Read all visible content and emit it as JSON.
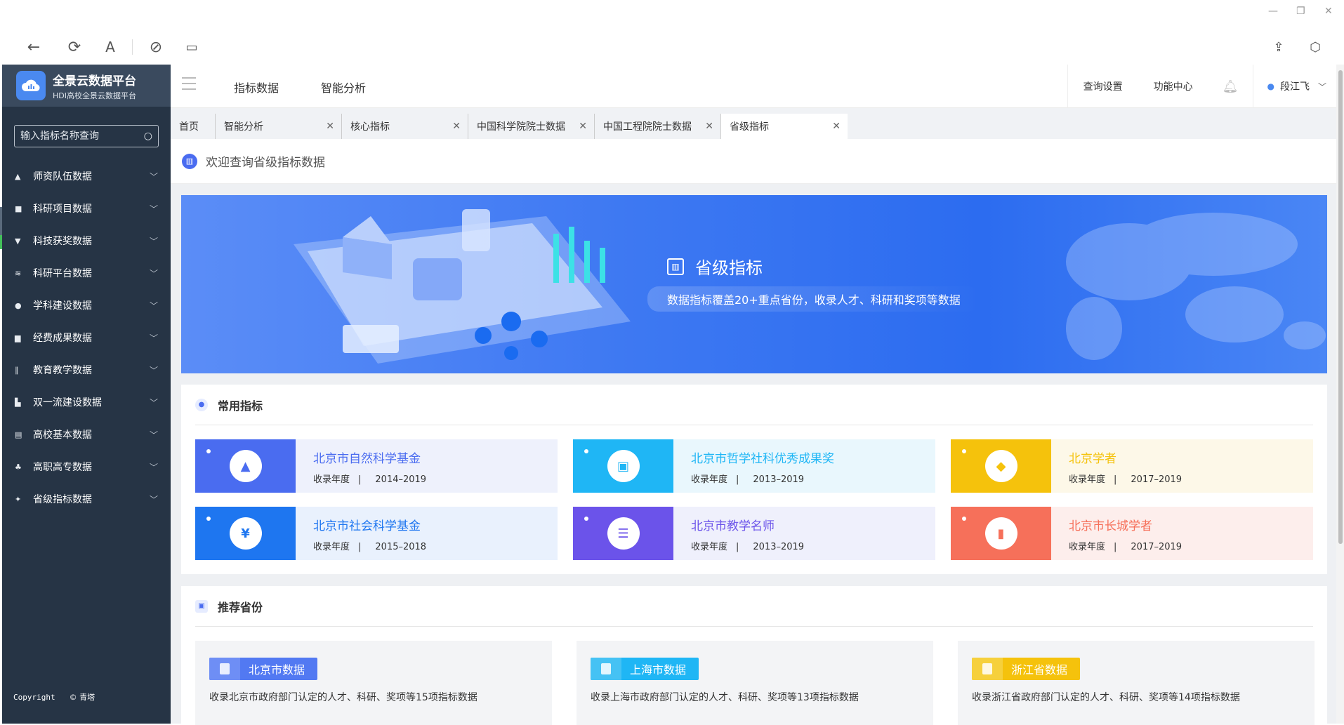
{
  "window": {
    "minimize": "—",
    "restore": "❐",
    "close": "✕"
  },
  "browser": {
    "back": "←",
    "reload": "⟳",
    "font": "A",
    "link": "⊘",
    "reader": "▭",
    "share": "⇪",
    "ext": "⬡"
  },
  "brand": {
    "title": "全景云数据平台",
    "subtitle": "HDI高校全景云数据平台"
  },
  "search": {
    "placeholder": "输入指标名称查询"
  },
  "sidebar": {
    "items": [
      {
        "label": "师资队伍数据",
        "icon": "graduation-cap-icon",
        "glyph": "▲"
      },
      {
        "label": "科研项目数据",
        "icon": "folder-icon",
        "glyph": "■"
      },
      {
        "label": "科技获奖数据",
        "icon": "trophy-icon",
        "glyph": "▼"
      },
      {
        "label": "科研平台数据",
        "icon": "layers-icon",
        "glyph": "≋"
      },
      {
        "label": "学科建设数据",
        "icon": "location-icon",
        "glyph": "●"
      },
      {
        "label": "经费成果数据",
        "icon": "briefcase-icon",
        "glyph": "▆"
      },
      {
        "label": "教育教学数据",
        "icon": "bar-chart-icon",
        "glyph": "∥"
      },
      {
        "label": "双一流建设数据",
        "icon": "document-icon",
        "glyph": "▙"
      },
      {
        "label": "高校基本数据",
        "icon": "list-icon",
        "glyph": "▤"
      },
      {
        "label": "高职高专数据",
        "icon": "people-icon",
        "glyph": "♣"
      },
      {
        "label": "省级指标数据",
        "icon": "map-icon",
        "glyph": "✦"
      }
    ],
    "copyright_label": "Copyright",
    "copyright_owner": "© 青塔"
  },
  "topnav": {
    "links": [
      "指标数据",
      "智能分析"
    ],
    "query_settings": "查询设置",
    "function_center": "功能中心",
    "user_name": "段江飞"
  },
  "tabs": [
    {
      "label": "首页",
      "closable": false
    },
    {
      "label": "智能分析",
      "closable": true
    },
    {
      "label": "核心指标",
      "closable": true
    },
    {
      "label": "中国科学院院士数据",
      "closable": true
    },
    {
      "label": "中国工程院院士数据",
      "closable": true
    },
    {
      "label": "省级指标",
      "closable": true,
      "active": true
    }
  ],
  "welcome": {
    "text": "欢迎查询省级指标数据"
  },
  "banner": {
    "title": "省级指标",
    "subtitle": "数据指标覆盖20+重点省份，收录人才、科研和奖项等数据"
  },
  "common": {
    "title": "常用指标",
    "year_label": "收录年度",
    "cards": [
      {
        "title": "北京市自然科学基金",
        "years": "2014–2019",
        "color": "#4a6cf0",
        "bg": "#eef1fc",
        "icon": "growth-chart-icon",
        "glyph": "▲"
      },
      {
        "title": "北京市哲学社科优秀成果奖",
        "years": "2013–2019",
        "color": "#1fb6f5",
        "bg": "#e9f7fd",
        "icon": "presentation-icon",
        "glyph": "▣"
      },
      {
        "title": "北京学者",
        "years": "2017–2019",
        "color": "#f5c20c",
        "bg": "#fdf8e8",
        "icon": "graduation-cap-icon",
        "glyph": "◆"
      },
      {
        "title": "北京市社会科学基金",
        "years": "2015–2018",
        "color": "#1e76f0",
        "bg": "#e9f1fd",
        "icon": "money-icon",
        "glyph": "¥"
      },
      {
        "title": "北京市教学名师",
        "years": "2013–2019",
        "color": "#6b53ea",
        "bg": "#eff0fc",
        "icon": "server-icon",
        "glyph": "☰"
      },
      {
        "title": "北京市长城学者",
        "years": "2017–2019",
        "color": "#f6705a",
        "bg": "#fdeeec",
        "icon": "bar-chart-icon",
        "glyph": "▮"
      }
    ]
  },
  "provinces": {
    "title": "推荐省份",
    "items": [
      {
        "name": "北京市数据",
        "desc": "收录北京市政府部门认定的人才、科研、奖项等15项指标数据",
        "color": "#6e8ef5",
        "accent": "#5279f2"
      },
      {
        "name": "上海市数据",
        "desc": "收录上海市政府部门认定的人才、科研、奖项等13项指标数据",
        "color": "#45c2f4",
        "accent": "#1fb6f5"
      },
      {
        "name": "浙江省数据",
        "desc": "收录浙江省政府部门认定的人才、科研、奖项等14项指标数据",
        "color": "#f6d03c",
        "accent": "#f5c20c"
      }
    ]
  }
}
